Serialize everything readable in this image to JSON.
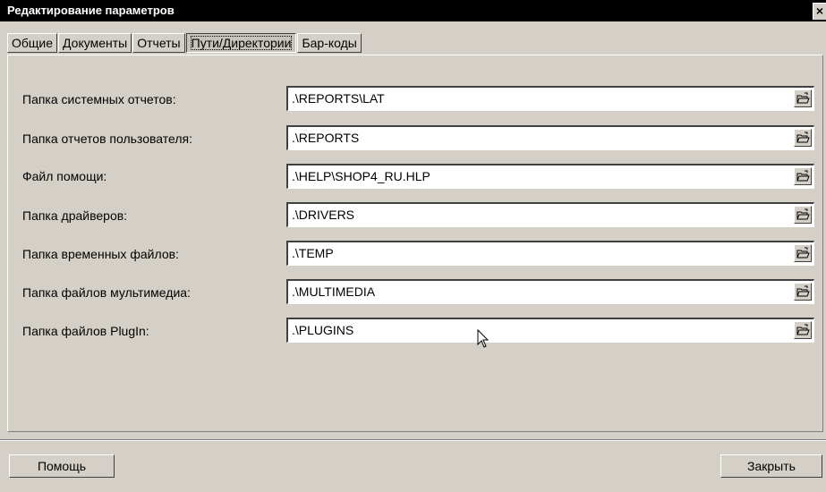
{
  "window": {
    "title": "Редактирование параметров",
    "close_glyph": "×"
  },
  "tabs": [
    {
      "label": "Общие",
      "active": false
    },
    {
      "label": "Документы",
      "active": false
    },
    {
      "label": "Отчеты",
      "active": false
    },
    {
      "label": "Пути/Директории",
      "active": true
    },
    {
      "label": "Бар-коды",
      "active": false
    }
  ],
  "paths": [
    {
      "label": "Папка системных отчетов:",
      "value": ".\\REPORTS\\LAT"
    },
    {
      "label": "Папка отчетов пользователя:",
      "value": ".\\REPORTS"
    },
    {
      "label": "Файл помощи:",
      "value": ".\\HELP\\SHOP4_RU.HLP"
    },
    {
      "label": "Папка драйверов:",
      "value": ".\\DRIVERS"
    },
    {
      "label": "Папка временных файлов:",
      "value": ".\\TEMP"
    },
    {
      "label": "Папка файлов мультимедиа:",
      "value": ".\\MULTIMEDIA"
    },
    {
      "label": "Папка файлов PlugIn:",
      "value": ".\\PLUGINS"
    }
  ],
  "browse_icon": "open-folder-icon",
  "buttons": {
    "help": "Помощь",
    "close": "Закрыть"
  },
  "colors": {
    "titlebar": "#000000",
    "face": "#d4d0c8",
    "field": "#ffffff"
  }
}
